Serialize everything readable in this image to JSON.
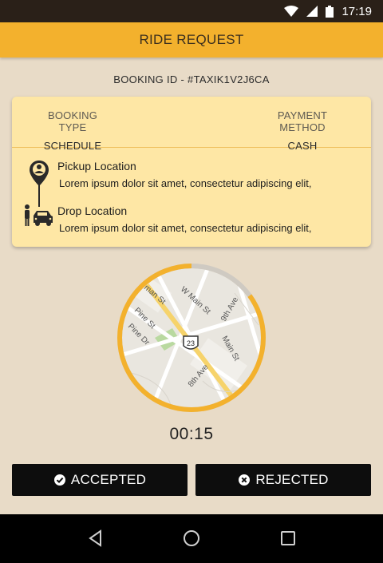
{
  "status_bar": {
    "time": "17:19",
    "icons": [
      "wifi-icon",
      "signal-icon",
      "battery-icon"
    ]
  },
  "header": {
    "title": "RIDE REQUEST"
  },
  "booking": {
    "id_text": "BOOKING ID - #TAXIK1V2J6CA"
  },
  "card": {
    "booking_type_label": "BOOKING TYPE",
    "booking_type_value": "SCHEDULE",
    "payment_method_label": "PAYMENT METHOD",
    "payment_method_value": "CASH",
    "pickup": {
      "title": "Pickup Location",
      "address": "Lorem ipsum dolor sit amet, consectetur adipiscing elit,"
    },
    "drop": {
      "title": "Drop Location",
      "address": "Lorem ipsum dolor sit amet, consectetur adipiscing elit,"
    }
  },
  "map": {
    "street_labels": [
      "man St",
      "W Main St",
      "9th Ave",
      "Pine St",
      "Pine Dr",
      "Main St",
      "8th Ave"
    ],
    "route_shield": "23",
    "progress_fraction": 0.85
  },
  "timer": {
    "value": "00:15"
  },
  "actions": {
    "accept_label": "ACCEPTED",
    "reject_label": "REJECTED"
  },
  "nav": {
    "icons": [
      "back-icon",
      "home-icon",
      "recents-icon"
    ]
  },
  "colors": {
    "accent": "#f3b12d",
    "background": "#e8dbc7",
    "card": "#fee7a5",
    "button": "#0d0d0d"
  }
}
